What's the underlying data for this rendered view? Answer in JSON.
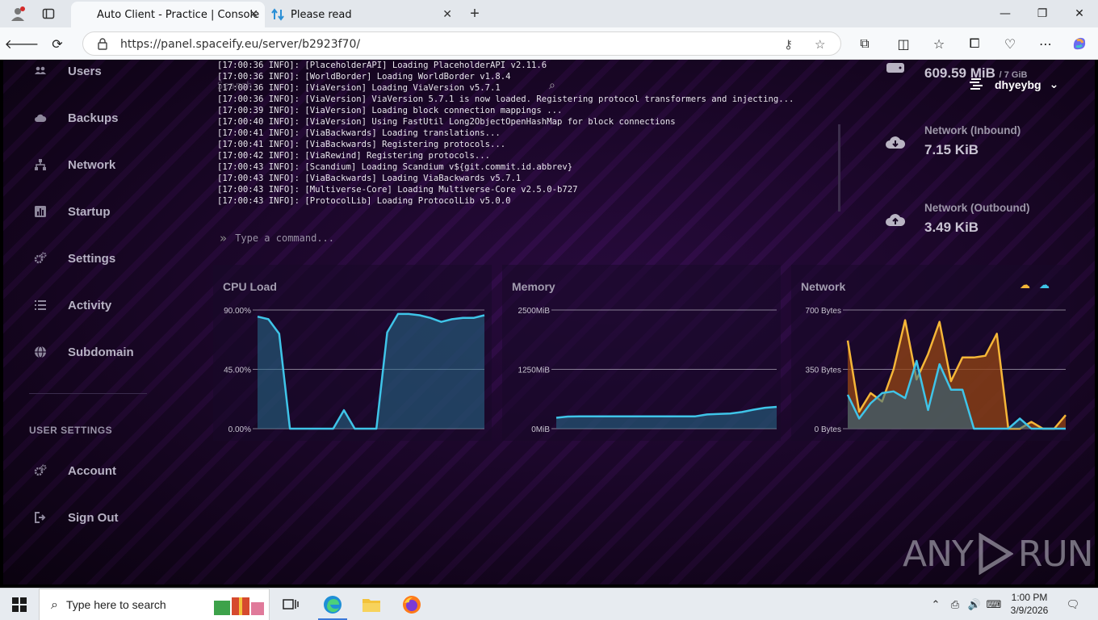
{
  "browser": {
    "tabs": [
      {
        "title": "Auto Client - Practice | Console",
        "active": true
      },
      {
        "title": "Please read",
        "active": false
      }
    ],
    "url": "https://panel.spaceify.eu/server/b2923f70/",
    "new_tab": "+"
  },
  "sidebar": {
    "items": [
      {
        "label": "Users",
        "icon": "users-icon"
      },
      {
        "label": "Backups",
        "icon": "cloud-icon"
      },
      {
        "label": "Network",
        "icon": "network-icon"
      },
      {
        "label": "Startup",
        "icon": "chart-icon"
      },
      {
        "label": "Settings",
        "icon": "gears-icon"
      },
      {
        "label": "Activity",
        "icon": "list-icon"
      },
      {
        "label": "Subdomain",
        "icon": "globe-icon"
      }
    ],
    "section_heading": "USER SETTINGS",
    "user_items": [
      {
        "label": "Account",
        "icon": "gears-icon"
      },
      {
        "label": "Sign Out",
        "icon": "sign-out-icon"
      }
    ]
  },
  "console": {
    "lines": [
      "[17:00:36 INFO]: [PlaceholderAPI] Loading PlaceholderAPI v2.11.6",
      "[17:00:36 INFO]: [WorldBorder] Loading WorldBorder v1.8.4",
      "[17:00:36 INFO]: [ViaVersion] Loading ViaVersion v5.7.1",
      "[17:00:36 INFO]: [ViaVersion] ViaVersion 5.7.1 is now loaded. Registering protocol transformers and injecting...",
      "[17:00:39 INFO]: [ViaVersion] Loading block connection mappings ...",
      "[17:00:40 INFO]: [ViaVersion] Using FastUtil Long2ObjectOpenHashMap for block connections",
      "[17:00:41 INFO]: [ViaBackwards] Loading translations...",
      "[17:00:41 INFO]: [ViaBackwards] Registering protocols...",
      "[17:00:42 INFO]: [ViaRewind] Registering protocols...",
      "[17:00:43 INFO]: [Scandium] Loading Scandium v${git.commit.id.abbrev}",
      "[17:00:43 INFO]: [ViaBackwards] Loading ViaBackwards v5.7.1",
      "[17:00:43 INFO]: [Multiverse-Core] Loading Multiverse-Core v2.5.0-b727",
      "[17:00:43 INFO]: [ProtocolLib] Loading ProtocolLib v5.0.0"
    ],
    "search_ghost": "Search",
    "command_placeholder": "Type a command..."
  },
  "user": {
    "name": "dhyeybg"
  },
  "stats": {
    "memory": {
      "value": "609.59 MiB",
      "limit": "/ 7 GiB"
    },
    "inbound": {
      "label": "Network (Inbound)",
      "value": "7.15 KiB"
    },
    "outbound": {
      "label": "Network (Outbound)",
      "value": "3.49 KiB"
    }
  },
  "chart_data": [
    {
      "type": "area",
      "title": "CPU Load",
      "ylim": [
        0,
        90
      ],
      "yticks": [
        "90.00%",
        "45.00%",
        "0.00%"
      ],
      "series": [
        {
          "color": "#3fc4e8",
          "values": [
            85,
            83,
            72,
            0,
            0,
            0,
            0,
            0,
            14,
            0,
            0,
            0,
            73,
            87,
            87,
            86,
            84,
            81,
            83,
            84,
            84,
            86
          ]
        }
      ]
    },
    {
      "type": "area",
      "title": "Memory",
      "ylim": [
        0,
        2500
      ],
      "yticks": [
        "2500MiB",
        "1250MiB",
        "0MiB"
      ],
      "series": [
        {
          "color": "#3fc4e8",
          "values": [
            230,
            255,
            260,
            260,
            260,
            260,
            260,
            260,
            260,
            260,
            260,
            260,
            260,
            300,
            310,
            320,
            350,
            400,
            440,
            460
          ]
        }
      ]
    },
    {
      "type": "area",
      "title": "Network",
      "ylim": [
        0,
        700
      ],
      "yticks": [
        "700 Bytes",
        "350 Bytes",
        "0 Bytes"
      ],
      "series": [
        {
          "color": "#f5b638",
          "values": [
            520,
            100,
            210,
            160,
            350,
            640,
            290,
            440,
            630,
            280,
            420,
            420,
            430,
            560,
            0,
            0,
            40,
            0,
            0,
            80
          ]
        },
        {
          "color": "#3fc4e8",
          "values": [
            200,
            60,
            150,
            210,
            220,
            180,
            400,
            110,
            380,
            230,
            230,
            0,
            0,
            0,
            0,
            60,
            0,
            0,
            0,
            0
          ]
        }
      ]
    }
  ],
  "watermark": {
    "left": "ANY",
    "right": "RUN"
  },
  "taskbar": {
    "search_placeholder": "Type here to search",
    "time": "1:00 PM",
    "date": "3/9/2026"
  }
}
